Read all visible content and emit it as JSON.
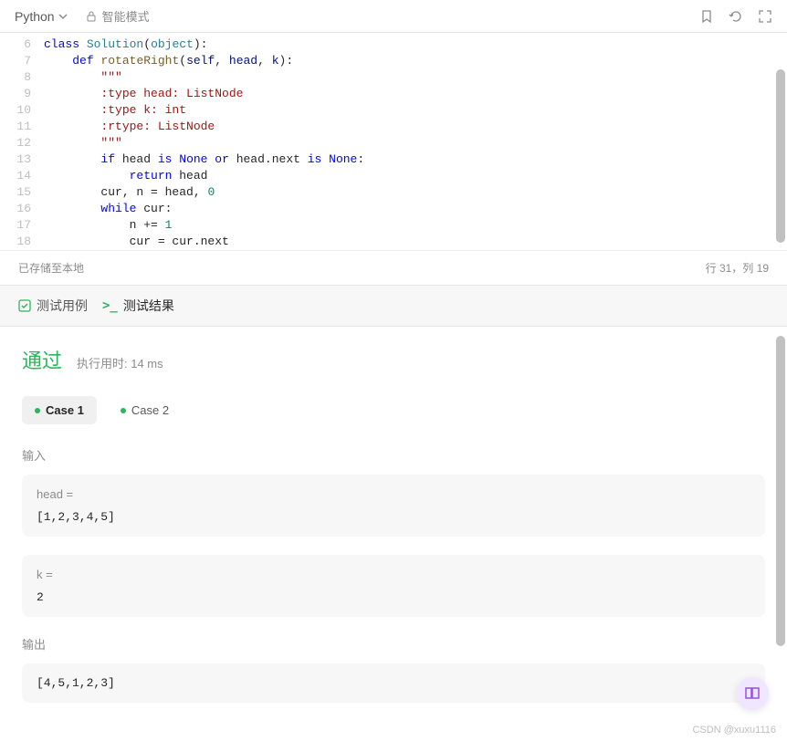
{
  "toolbar": {
    "language": "Python",
    "mode_label": "智能模式"
  },
  "code": {
    "lines": [
      {
        "num": 6,
        "html": "<span class='kw-class'>class</span> <span class='cls-name'>Solution</span>(<span class='obj-name'>object</span>):"
      },
      {
        "num": 7,
        "html": "    <span class='kw-def'>def</span> <span class='fn-name'>rotateRight</span>(<span class='param'>self</span>, <span class='param'>head</span>, <span class='param'>k</span>):"
      },
      {
        "num": 8,
        "html": "        <span class='str'>\"\"\"</span>"
      },
      {
        "num": 9,
        "html": "<span class='str'>        :type head: ListNode</span>"
      },
      {
        "num": 10,
        "html": "<span class='str'>        :type k: int</span>"
      },
      {
        "num": 11,
        "html": "<span class='str'>        :rtype: ListNode</span>"
      },
      {
        "num": 12,
        "html": "<span class='str'>        \"\"\"</span>"
      },
      {
        "num": 13,
        "html": "        <span class='kw-if'>if</span> head <span class='kw-is'>is</span> <span class='kw-None'>None</span> <span class='kw-or'>or</span> head.next <span class='kw-is'>is</span> <span class='kw-None'>None</span>:"
      },
      {
        "num": 14,
        "html": "            <span class='kw-return'>return</span> head"
      },
      {
        "num": 15,
        "html": "        cur, n = head, <span class='num'>0</span>"
      },
      {
        "num": 16,
        "html": "        <span class='kw-while'>while</span> cur:"
      },
      {
        "num": 17,
        "html": "            n += <span class='num'>1</span>"
      },
      {
        "num": 18,
        "html": "            cur = cur.next"
      }
    ]
  },
  "status": {
    "saved": "已存储至本地",
    "position": "行 31，列 19"
  },
  "results": {
    "tab_testcase": "测试用例",
    "tab_result": "测试结果",
    "pass_label": "通过",
    "runtime": "执行用时: 14 ms",
    "cases": [
      "Case 1",
      "Case 2"
    ],
    "input_label": "输入",
    "output_label": "输出",
    "inputs": [
      {
        "var": "head =",
        "val": "[1,2,3,4,5]"
      },
      {
        "var": "k =",
        "val": "2"
      }
    ],
    "output": "[4,5,1,2,3]"
  },
  "watermark": "CSDN @xuxu1116"
}
